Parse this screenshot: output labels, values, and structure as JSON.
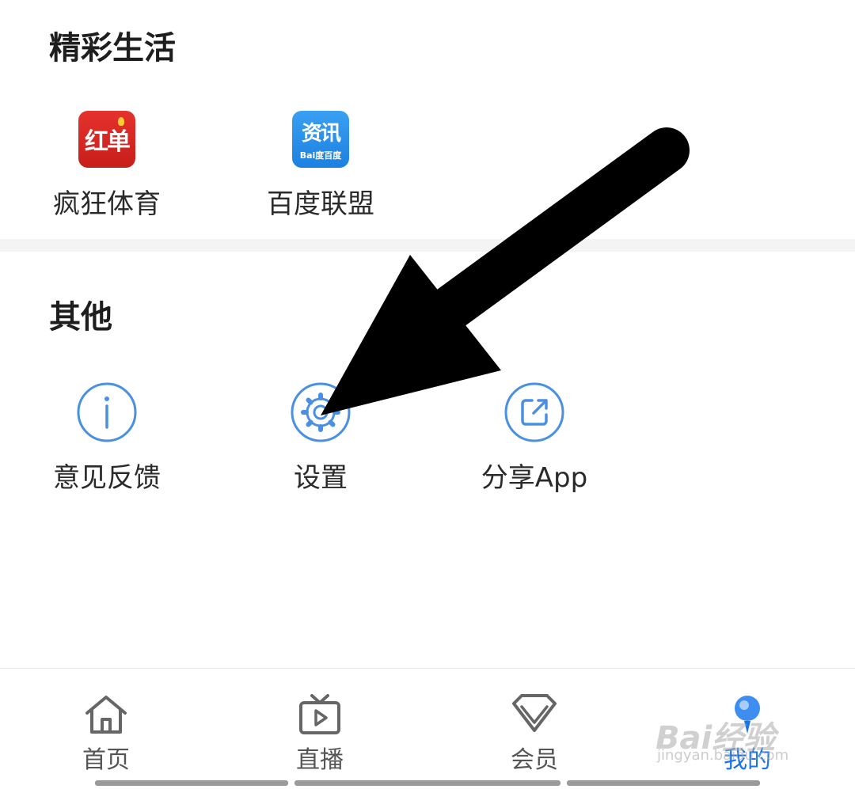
{
  "sections": {
    "life": {
      "title": "精彩生活",
      "items": [
        {
          "label": "疯狂体育",
          "icon": "hongdan-app-icon",
          "icon_text": "红单"
        },
        {
          "label": "百度联盟",
          "icon": "zixun-app-icon",
          "icon_text": "资讯",
          "icon_sub": "Bai度百度"
        }
      ]
    },
    "other": {
      "title": "其他",
      "items": [
        {
          "label": "意见反馈",
          "icon": "info-icon"
        },
        {
          "label": "设置",
          "icon": "gear-icon"
        },
        {
          "label": "分享App",
          "icon": "share-icon"
        }
      ]
    }
  },
  "tabbar": {
    "tabs": [
      {
        "label": "首页",
        "icon": "home-icon"
      },
      {
        "label": "直播",
        "icon": "tv-play-icon"
      },
      {
        "label": "会员",
        "icon": "diamond-icon"
      },
      {
        "label": "我的",
        "icon": "profile-icon",
        "active": true
      }
    ]
  },
  "watermark": {
    "text": "Bai经验",
    "url": "jingyan.baidu.com"
  },
  "colors": {
    "accent": "#1a73e8",
    "icon_stroke": "#4a90e2",
    "red_icon": "#d42a25",
    "blue_icon": "#2a8fe8"
  }
}
